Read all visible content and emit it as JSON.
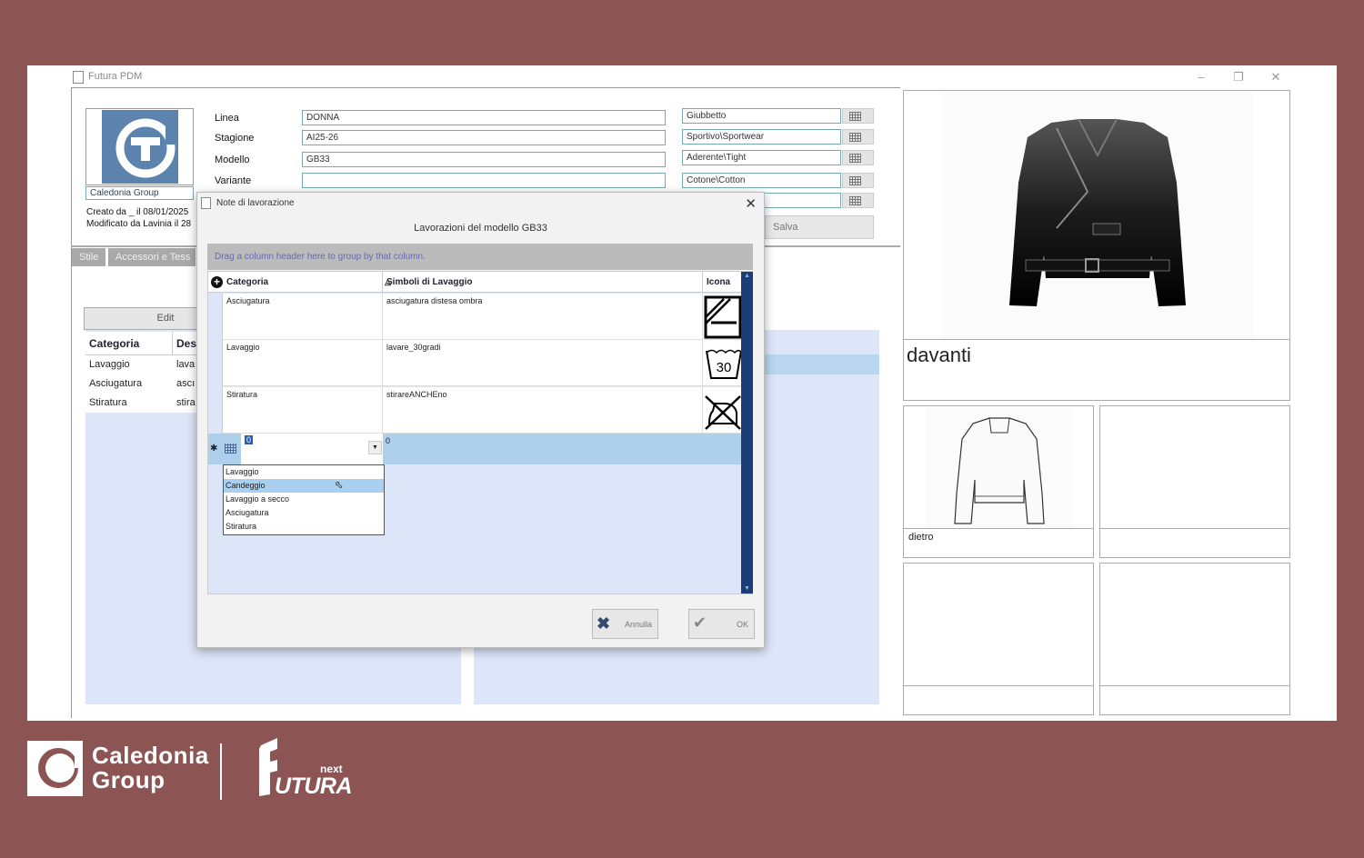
{
  "app": {
    "title": "Futura PDM"
  },
  "header": {
    "logo_label": "Caledonia Group",
    "created": "Creato da _ il 08/01/2025",
    "modified": "Modificato da Lavinia il 28",
    "fields": [
      {
        "label": "Linea",
        "value": "DONNA"
      },
      {
        "label": "Stagione",
        "value": "AI25-26"
      },
      {
        "label": "Modello",
        "value": "GB33"
      },
      {
        "label": "Variante",
        "value": ""
      }
    ],
    "right_fields": [
      "Giubbetto",
      "Sportivo\\Sportwear",
      "Aderente\\Tight",
      "Cotone\\Cotton",
      ""
    ],
    "save_label": "Salva"
  },
  "tabs": [
    "Stile",
    "Accessori e Tess"
  ],
  "background_panel": {
    "edit_label": "Edit",
    "columns": [
      "Categoria",
      "Des"
    ],
    "rows": [
      [
        "Lavaggio",
        "lava"
      ],
      [
        "Asciugatura",
        "ascı"
      ],
      [
        "Stiratura",
        "stira"
      ]
    ]
  },
  "images": {
    "front_label": "davanti",
    "back_label": "dietro"
  },
  "dialog": {
    "title": "Note di lavorazione",
    "subtitle": "Lavorazioni del modello GB33",
    "group_hint": "Drag a column header here to group by that column.",
    "columns": [
      "Categoria",
      "Simboli di Lavaggio",
      "Icona"
    ],
    "rows": [
      {
        "category": "Asciugatura",
        "symbol": "asciugatura distesa ombra",
        "icon": "dry-flat-shade-icon"
      },
      {
        "category": "Lavaggio",
        "symbol": "lavare_30gradi",
        "icon": "wash-30-icon"
      },
      {
        "category": "Stiratura",
        "symbol": "stirareANCHEno",
        "icon": "do-not-iron-icon"
      }
    ],
    "new_row": {
      "category_value": "0",
      "symbol_value": "0"
    },
    "dropdown_options": [
      "Lavaggio",
      "Candeggio",
      "Lavaggio a secco",
      "Asciugatura",
      "Stiratura"
    ],
    "dropdown_selected": "Candeggio",
    "wash_temp": "30",
    "cancel_label": "Annulla",
    "ok_label": "OK"
  },
  "branding": {
    "caledonia_line1": "Caledonia",
    "caledonia_line2": "Group",
    "futura_next": "next",
    "futura_name": "UTURA"
  }
}
